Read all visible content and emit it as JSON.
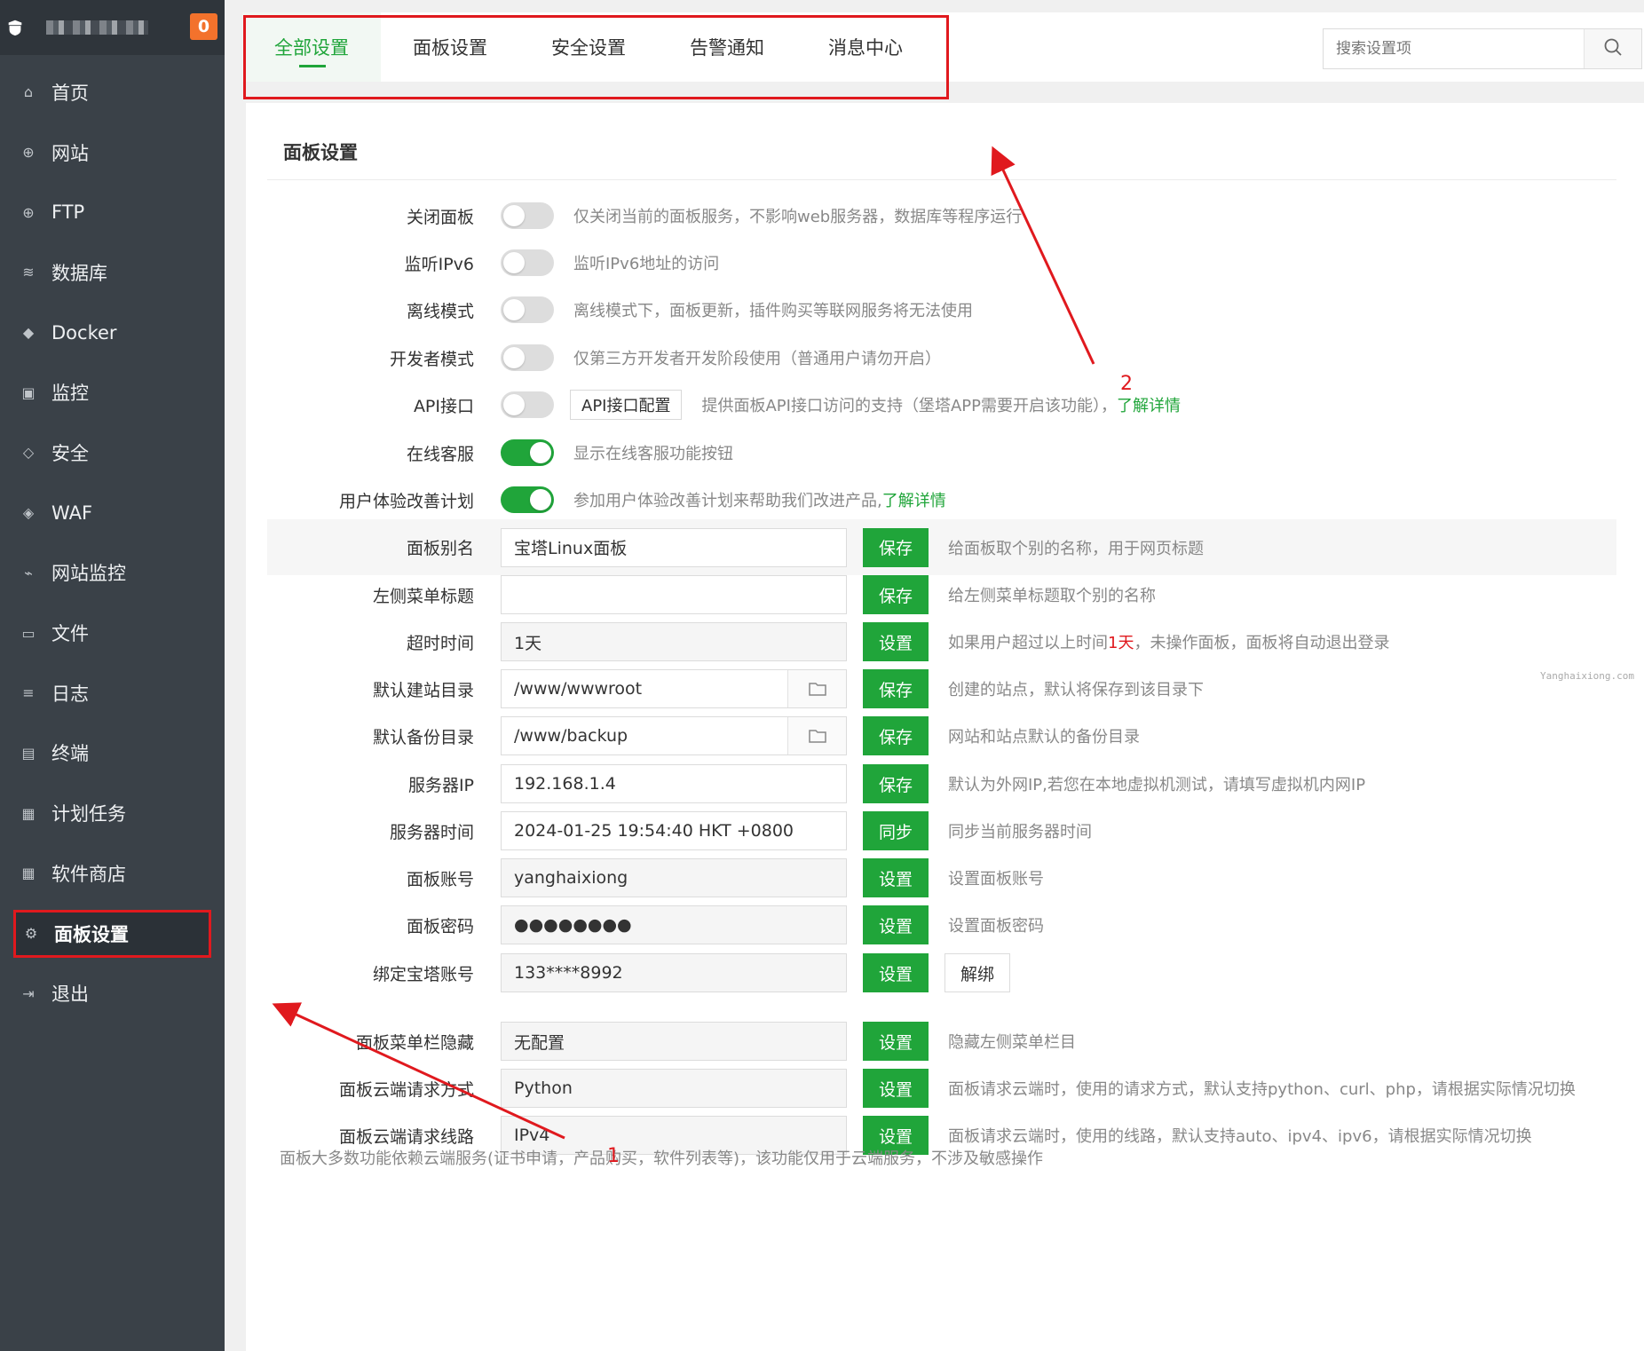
{
  "sidebar": {
    "badge": "0",
    "items": [
      {
        "label": "首页",
        "icon": "home-icon",
        "glyph": "⌂"
      },
      {
        "label": "网站",
        "icon": "globe-icon",
        "glyph": "⊕"
      },
      {
        "label": "FTP",
        "icon": "ftp-icon",
        "glyph": "⊕"
      },
      {
        "label": "数据库",
        "icon": "database-icon",
        "glyph": "≋"
      },
      {
        "label": "Docker",
        "icon": "docker-icon",
        "glyph": "◆"
      },
      {
        "label": "监控",
        "icon": "monitor-icon",
        "glyph": "▣"
      },
      {
        "label": "安全",
        "icon": "shield-icon",
        "glyph": "◇"
      },
      {
        "label": "WAF",
        "icon": "waf-icon",
        "glyph": "◈"
      },
      {
        "label": "网站监控",
        "icon": "site-monitor-icon",
        "glyph": "⌁"
      },
      {
        "label": "文件",
        "icon": "folder-icon",
        "glyph": "▭"
      },
      {
        "label": "日志",
        "icon": "log-icon",
        "glyph": "≡"
      },
      {
        "label": "终端",
        "icon": "terminal-icon",
        "glyph": "▤"
      },
      {
        "label": "计划任务",
        "icon": "calendar-icon",
        "glyph": "▦"
      },
      {
        "label": "软件商店",
        "icon": "grid-icon",
        "glyph": "▦"
      },
      {
        "label": "面板设置",
        "icon": "gear-icon",
        "glyph": "⚙"
      },
      {
        "label": "退出",
        "icon": "logout-icon",
        "glyph": "⇥"
      }
    ]
  },
  "tabs": [
    "全部设置",
    "面板设置",
    "安全设置",
    "告警通知",
    "消息中心"
  ],
  "search": {
    "placeholder": "搜索设置项"
  },
  "panel": {
    "title": "面板设置",
    "toggles": [
      {
        "label": "关闭面板",
        "on": false,
        "desc": "仅关闭当前的面板服务，不影响web服务器，数据库等程序运行"
      },
      {
        "label": "监听IPv6",
        "on": false,
        "desc": "监听IPv6地址的访问"
      },
      {
        "label": "离线模式",
        "on": false,
        "desc": "离线模式下，面板更新，插件购买等联网服务将无法使用"
      },
      {
        "label": "开发者模式",
        "on": false,
        "desc": "仅第三方开发者开发阶段使用（普通用户请勿开启）"
      },
      {
        "label": "API接口",
        "on": false,
        "button": "API接口配置",
        "desc": "提供面板API接口访问的支持（堡塔APP需要开启该功能），",
        "link": "了解详情"
      },
      {
        "label": "在线客服",
        "on": true,
        "desc": "显示在线客服功能按钮"
      },
      {
        "label": "用户体验改善计划",
        "on": true,
        "desc": "参加用户体验改善计划来帮助我们改进产品,",
        "link": "了解详情"
      }
    ],
    "fields": [
      {
        "label": "面板别名",
        "value": "宝塔Linux面板",
        "button": "保存",
        "desc": "给面板取个别的名称，用于网页标题"
      },
      {
        "label": "左侧菜单标题",
        "value": "",
        "button": "保存",
        "desc": "给左侧菜单标题取个别的名称"
      },
      {
        "label": "超时时间",
        "value": "1天",
        "button": "设置",
        "desc_a": "如果用户超过以上时间",
        "desc_red": "1天",
        "desc_b": "，未操作面板，面板将自动退出登录"
      },
      {
        "label": "默认建站目录",
        "value": "/www/wwwroot",
        "button": "保存",
        "desc": "创建的站点，默认将保存到该目录下"
      },
      {
        "label": "默认备份目录",
        "value": "/www/backup",
        "button": "保存",
        "desc": "网站和站点默认的备份目录"
      },
      {
        "label": "服务器IP",
        "value": "192.168.1.4",
        "button": "保存",
        "desc": "默认为外网IP,若您在本地虚拟机测试，请填写虚拟机内网IP"
      },
      {
        "label": "服务器时间",
        "value": "2024-01-25 19:54:40 HKT +0800",
        "button": "同步",
        "desc": "同步当前服务器时间"
      },
      {
        "label": "面板账号",
        "value": "yanghaixiong",
        "button": "设置",
        "desc": "设置面板账号"
      },
      {
        "label": "面板密码",
        "value": "●●●●●●●●",
        "button": "设置",
        "desc": "设置面板密码"
      },
      {
        "label": "绑定宝塔账号",
        "value": "133****8992",
        "button": "设置",
        "button2": "解绑"
      },
      {
        "label": "面板菜单栏隐藏",
        "value": "无配置",
        "button": "设置",
        "desc": "隐藏左侧菜单栏目"
      },
      {
        "label": "面板云端请求方式",
        "value": "Python",
        "button": "设置",
        "desc": "面板请求云端时，使用的请求方式，默认支持python、curl、php，请根据实际情况切换"
      },
      {
        "label": "面板云端请求线路",
        "value": "IPv4",
        "button": "设置",
        "desc": "面板请求云端时，使用的线路，默认支持auto、ipv4、ipv6，请根据实际情况切换"
      }
    ],
    "note": "面板大多数功能依赖云端服务(证书申请，产品购买，软件列表等)，该功能仅用于云端服务，不涉及敏感操作",
    "watermark": "Yanghaixiong.com"
  },
  "annotations": {
    "num1": "1",
    "num2": "2"
  }
}
